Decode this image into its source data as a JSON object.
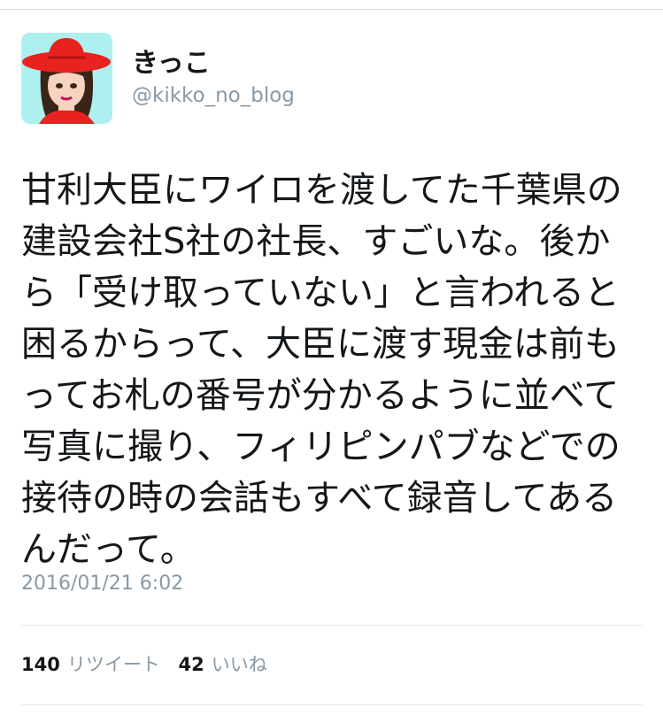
{
  "tweet": {
    "display_name": "きっこ",
    "handle": "@kikko_no_blog",
    "avatar_icon": "avatar-woman-red-hat-icon",
    "text": "甘利大臣にワイロを渡してた千葉県の建設会社S社の社長、すごいな。後から「受け取っていない」と言われると困るからって、大臣に渡す現金は前もってお札の番号が分かるように並べて写真に撮り、フィリピンパブなどでの接待の時の会話もすべて録音してあるんだって。",
    "timestamp": "2016/01/21 6:02"
  },
  "stats": {
    "retweet_count": "140",
    "retweet_label": "リツイート",
    "like_count": "42",
    "like_label": "いいね"
  },
  "colors": {
    "text": "#14171a",
    "muted": "#8899a6",
    "divider": "#e1e8ed",
    "avatar_bg": "#aef0f0",
    "hat_red": "#e8231f"
  }
}
